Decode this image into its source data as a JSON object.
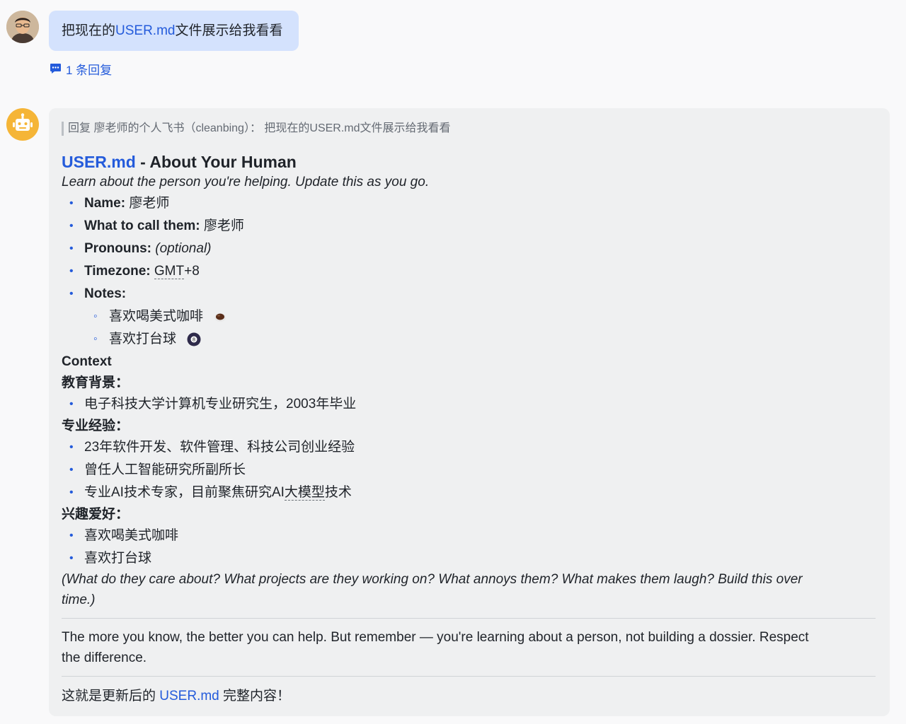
{
  "user_message": {
    "prefix": "把现在的",
    "link": "USER.md",
    "suffix": "文件展示给我看看",
    "reply_count": "1 条回复"
  },
  "bot_message": {
    "quote": "回复 廖老师的个人飞书（cleanbing）： 把现在的USER.md文件展示给我看看",
    "title_link": "USER.md",
    "title_rest": " - About Your Human",
    "intro": "Learn about the person you're helping. Update this as you go.",
    "fields": [
      {
        "label": "Name:",
        "value": " 廖老师"
      },
      {
        "label": "What to call them:",
        "value": " 廖老师"
      },
      {
        "label": "Pronouns:",
        "value": " (optional)"
      },
      {
        "label": "Timezone:",
        "value_underlined": "GMT",
        "value_rest": "+8"
      },
      {
        "label": "Notes:",
        "value": ""
      }
    ],
    "notes": [
      "喜欢喝美式咖啡",
      "喜欢打台球"
    ],
    "context_heading": "Context",
    "education_heading": "教育背景：",
    "education_items": [
      "电子科技大学计算机专业研究生，2003年毕业"
    ],
    "experience_heading": "专业经验：",
    "experience_items": [
      "23年软件开发、软件管理、科技公司创业经验",
      "曾任人工智能研究所副所长"
    ],
    "experience_item3": {
      "before": "专业AI技术专家，目前聚焦研究AI",
      "underlined": "大模型",
      "after": "技术"
    },
    "hobbies_heading": "兴趣爱好：",
    "hobbies_items": [
      "喜欢喝美式咖啡",
      "喜欢打台球"
    ],
    "closing_italic_1": "(What do they care about? What projects are they working on? What annoys them? What makes them laugh? Build this over",
    "closing_italic_2": "time.)",
    "footer_1": "The more you know, the better you can help. But remember — you're learning about a person, not building a dossier. Respect",
    "footer_2": "the difference.",
    "final_prefix": "这就是更新后的 ",
    "final_link": "USER.md",
    "final_suffix": " 完整内容！"
  },
  "colors": {
    "link": "#245bdb",
    "bubble": "#d4e2fd",
    "card": "#eff0f1",
    "bot_avatar": "#f5b537"
  },
  "icons": [
    "user-photo-avatar",
    "robot-avatar",
    "comment-icon",
    "coffee-emoji",
    "eight-ball-emoji"
  ]
}
